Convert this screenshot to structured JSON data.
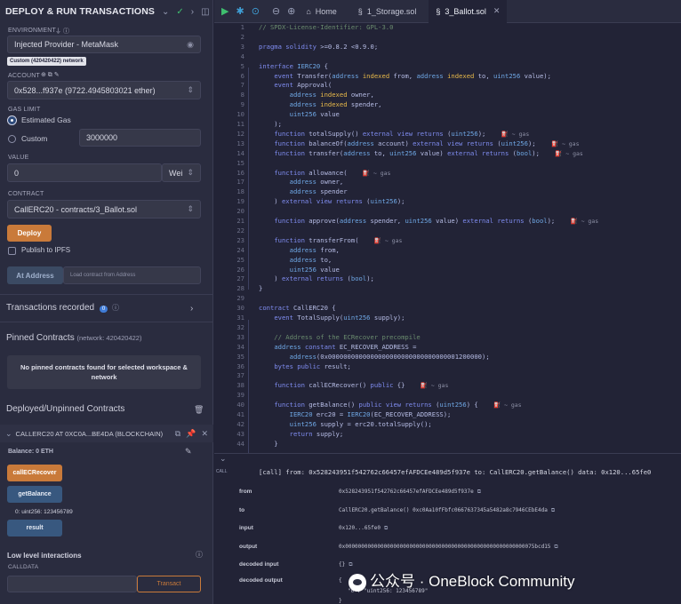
{
  "left_panel": {
    "title": "DEPLOY & RUN TRANSACTIONS",
    "environment_label": "ENVIRONMENT",
    "environment_value": "Injected Provider - MetaMask",
    "network_badge": "Custom (420420422) network",
    "account_label": "ACCOUNT",
    "account_value": "0x528...f937e (9722.4945803021 ether)",
    "gas_limit_label": "GAS LIMIT",
    "estimated_gas": "Estimated Gas",
    "custom_gas": "Custom",
    "custom_gas_value": "3000000",
    "value_label": "VALUE",
    "value_amount": "0",
    "value_unit": "Wei",
    "contract_label": "CONTRACT",
    "contract_value": "CallERC20 - contracts/3_Ballot.sol",
    "deploy_button": "Deploy",
    "publish_ipfs": "Publish to IPFS",
    "at_address_button": "At Address",
    "at_address_placeholder": "Load contract from Address",
    "transactions_recorded": "Transactions recorded",
    "transactions_count": "0",
    "pinned_title": "Pinned Contracts",
    "pinned_network": "(network: 420420422)",
    "pinned_empty": "No pinned contracts found for selected workspace & network",
    "deployed_title": "Deployed/Unpinned Contracts",
    "deployed_contract": "CALLERC20 AT 0XC0A...BE4DA (BLOCKCHAIN)",
    "balance": "Balance: 0 ETH",
    "btn_callecrecover": "callECRecover",
    "btn_getbalance": "getBalance",
    "getbalance_result": "0: uint256: 123456789",
    "btn_result": "result",
    "low_level": "Low level interactions",
    "calldata_label": "CALLDATA",
    "transact_button": "Transact"
  },
  "tabs": {
    "home": "Home",
    "storage": "1_Storage.sol",
    "ballot": "3_Ballot.sol"
  },
  "code_lines": [
    "// SPDX-License-Identifier: GPL-3.0",
    "",
    "pragma solidity >=0.8.2 <0.9.0;",
    "",
    "interface IERC20 {",
    "    event Transfer(address indexed from, address indexed to, uint256 value);",
    "    event Approval(",
    "        address indexed owner,",
    "        address indexed spender,",
    "        uint256 value",
    "    );",
    "    function totalSupply() external view returns (uint256);",
    "    function balanceOf(address account) external view returns (uint256);",
    "    function transfer(address to, uint256 value) external returns (bool);",
    "",
    "    function allowance(",
    "        address owner,",
    "        address spender",
    "    ) external view returns (uint256);",
    "",
    "    function approve(address spender, uint256 value) external returns (bool);",
    "",
    "    function transferFrom(",
    "        address from,",
    "        address to,",
    "        uint256 value",
    "    ) external returns (bool);",
    "}",
    "",
    "contract CallERC20 {",
    "    event TotalSupply(uint256 supply);",
    "",
    "    // Address of the ECRecover precompile",
    "    address constant EC_RECOVER_ADDRESS =",
    "        address(0x0000000000000000000000000000000001200000);",
    "    bytes public result;",
    "",
    "    function callECRecover() public {}",
    "",
    "    function getBalance() public view returns (uint256) {",
    "        IERC20 erc20 = IERC20(EC_RECOVER_ADDRESS);",
    "        uint256 supply = erc20.totalSupply();",
    "        return supply;",
    "    }"
  ],
  "gas_hint": "~ gas",
  "terminal": {
    "tag": "CALL",
    "log": "[call]  from: 0x528243951f542762c66457efAFDCEe489d5f937e to: CallERC20.getBalance() data: 0x120...65fe0",
    "rows": [
      {
        "k": "from",
        "v": "0x528243951f542762c66457efAFDCEe489d5f937e"
      },
      {
        "k": "to",
        "v": "CallERC20.getBalance() 0xc0Aa10fFbfc0667637345a5482a8c7946CEbE4da"
      },
      {
        "k": "input",
        "v": "0x120...65fe0"
      },
      {
        "k": "output",
        "v": "0x00000000000000000000000000000000000000000000000000000000075bcd15"
      },
      {
        "k": "decoded input",
        "v": "{}"
      },
      {
        "k": "decoded output",
        "v": "{"
      },
      {
        "k": "",
        "v": "\"0\": \"uint256: 123456789\""
      },
      {
        "k": "",
        "v": "}"
      }
    ]
  },
  "watermark": "公众号 · OneBlock Community",
  "colors": {
    "panel": "#2a2c3f",
    "editor": "#222336",
    "accent_orange": "#c97a3a",
    "accent_blue": "#38587f",
    "keyword": "#7f8cf0",
    "indexed": "#e8b94a"
  }
}
